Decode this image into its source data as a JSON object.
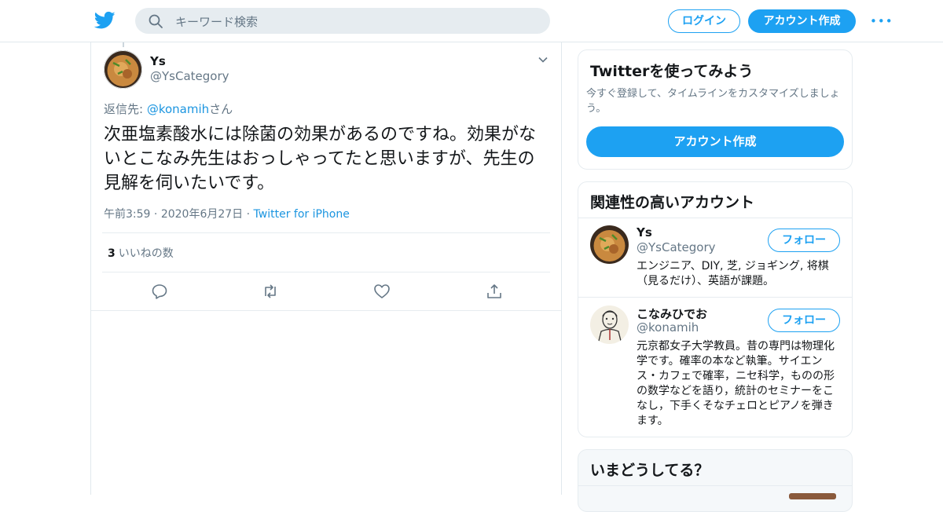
{
  "header": {
    "search_placeholder": "キーワード検索",
    "login_label": "ログイン",
    "signup_label": "アカウント作成",
    "more_label": "•••",
    "brand_color": "#1da1f2"
  },
  "tweet": {
    "name": "Ys",
    "handle": "@YsCategory",
    "reply_prefix": "返信先: ",
    "reply_mention": "@konamih",
    "reply_suffix": "さん",
    "text": "次亜塩素酸水には除菌の効果があるのですね。効果がないとこなみ先生はおっしゃってたと思いますが、先生の見解を伺いたいです。",
    "time": "午前3:59",
    "date": "2020年6月27日",
    "source": "Twitter for iPhone",
    "likes_count": "3",
    "likes_label": "いいねの数",
    "actions": [
      "reply-icon",
      "retweet-icon",
      "like-icon",
      "share-icon"
    ]
  },
  "sidebar": {
    "signup_card": {
      "title": "Twitterを使ってみよう",
      "subtitle": "今すぐ登録して、タイムラインをカスタマイズしましょう。",
      "button": "アカウント作成"
    },
    "related": {
      "title": "関連性の高いアカウント",
      "accounts": [
        {
          "name": "Ys",
          "handle": "@YsCategory",
          "bio": "エンジニア、DIY, 芝, ジョギング, 将棋（見るだけ）、英語が課題。",
          "follow_label": "フォロー"
        },
        {
          "name": "こなみひでお",
          "handle": "@konamih",
          "bio": "元京都女子大学教員。昔の専門は物理化学です。確率の本など執筆。サイエンス・カフェで確率，ニセ科学，ものの形の数学などを語り，統計のセミナーをこなし，下手くそなチェロとピアノを弾きます。",
          "follow_label": "フォロー"
        }
      ]
    },
    "trends": {
      "title": "いまどうしてる？"
    }
  }
}
